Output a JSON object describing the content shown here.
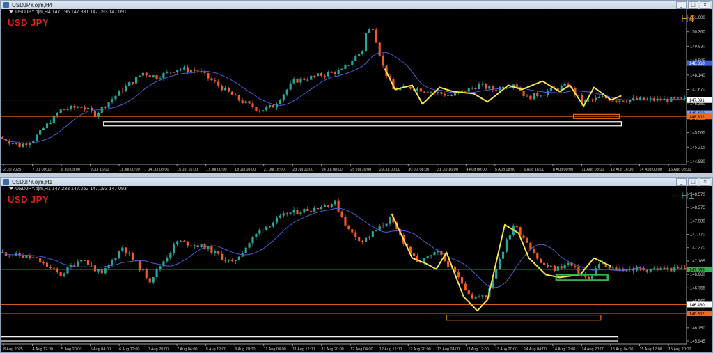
{
  "colors": {
    "bull": "#26a69a",
    "bear": "#ef5a24",
    "ma": "#4a5fd6",
    "zigzag": "#f5e14a",
    "grid": "#1b1b1b",
    "box_white": "#ffffff",
    "box_orange": "#ef6a1a",
    "box_green": "#31b24a",
    "h4_label": "#e7901f",
    "h1_label": "#1aa39a"
  },
  "windows": [
    {
      "id": "h4",
      "title": "USDJPY.ojm,H4",
      "info": "USDJPY.ojm,H4  147.196 147.331 147.093 147.091",
      "symbol": "USD JPY",
      "timeframe": "H4",
      "buttons": [
        "_",
        "□",
        "×"
      ],
      "y_min": 144.0,
      "y_max": 151.2,
      "price_ticks": [
        "151.000",
        "150.360",
        "149.930",
        "149.595",
        "148.140",
        "147.670",
        "146.380",
        "145.980",
        "145.565",
        "145.215",
        "144.880"
      ],
      "price_tags": [
        {
          "text": "148.868",
          "y": 148.868,
          "bg": "#3a5fd8",
          "fg": "#ffffff"
        },
        {
          "text": "147.091",
          "y": 147.091,
          "bg": "#ffffff",
          "fg": "#000000"
        },
        {
          "text": "146.460",
          "y": 146.46,
          "bg": "#7aa1ff",
          "fg": "#000000"
        },
        {
          "text": "146.302",
          "y": 146.302,
          "bg": "#ef6a1a",
          "fg": "#000000"
        }
      ],
      "time_labels": [
        "2 Jul 2025",
        "7 Jul 00:00",
        "8 Jul 08:00",
        "9 Jul 16:00",
        "11 Jul 00:00",
        "14 Jul 08:00",
        "15 Jul 16:00",
        "17 Jul 00:00",
        "18 Jul 08:00",
        "21 Jul 16:00",
        "23 Jul 00:00",
        "24 Jul 08:00",
        "25 Jul 16:00",
        "29 Jul 00:00",
        "30 Jul 08:00",
        "31 Jul 16:00",
        "4 Aug 00:00",
        "5 Aug 08:00",
        "6 Aug 16:00",
        "8 Aug 00:00",
        "11 Aug 08:00",
        "12 Aug 16:00",
        "14 Aug 00:00",
        "15 Aug 08:00"
      ]
    },
    {
      "id": "h1",
      "title": "USDJPY.ojm,H1",
      "info": "USDJPY.ojm,H1  147.233 147.252 147.093 147.093",
      "symbol": "USD JPY",
      "timeframe": "H1",
      "buttons": [
        "_",
        "□",
        "×"
      ],
      "y_min": 145.75,
      "y_max": 148.5,
      "price_ticks": [
        "148.570",
        "148.375",
        "147.980",
        "147.770",
        "147.370",
        "147.165",
        "146.960",
        "146.765",
        "146.560",
        "146.355",
        "146.150",
        "145.945"
      ],
      "price_tags": [
        {
          "text": "147.093",
          "y": 147.093,
          "bg": "#31b24a",
          "fg": "#000000"
        },
        {
          "text": "146.460",
          "y": 146.46,
          "bg": "#ffffff",
          "fg": "#000000"
        },
        {
          "text": "146.302",
          "y": 146.302,
          "bg": "#ef6a1a",
          "fg": "#000000"
        }
      ],
      "time_labels": [
        "8 Aug 2025",
        "4 Aug 12:00",
        "5 Aug 20:00",
        "5 Aug 04:00",
        "6 Aug 12:00",
        "7 Aug 20:00",
        "7 Aug 04:00",
        "8 Aug 12:00",
        "8 Aug 20:00",
        "11 Aug 04:00",
        "11 Aug 12:00",
        "11 Aug 20:00",
        "12 Aug 04:00",
        "12 Aug 12:00",
        "12 Aug 20:00",
        "13 Aug 04:00",
        "13 Aug 12:00",
        "13 Aug 20:00",
        "14 Aug 04:00",
        "14 Aug 12:00",
        "14 Aug 20:00",
        "15 Aug 04:00",
        "15 Aug 12:00",
        "15 Aug 20:00"
      ]
    }
  ]
}
